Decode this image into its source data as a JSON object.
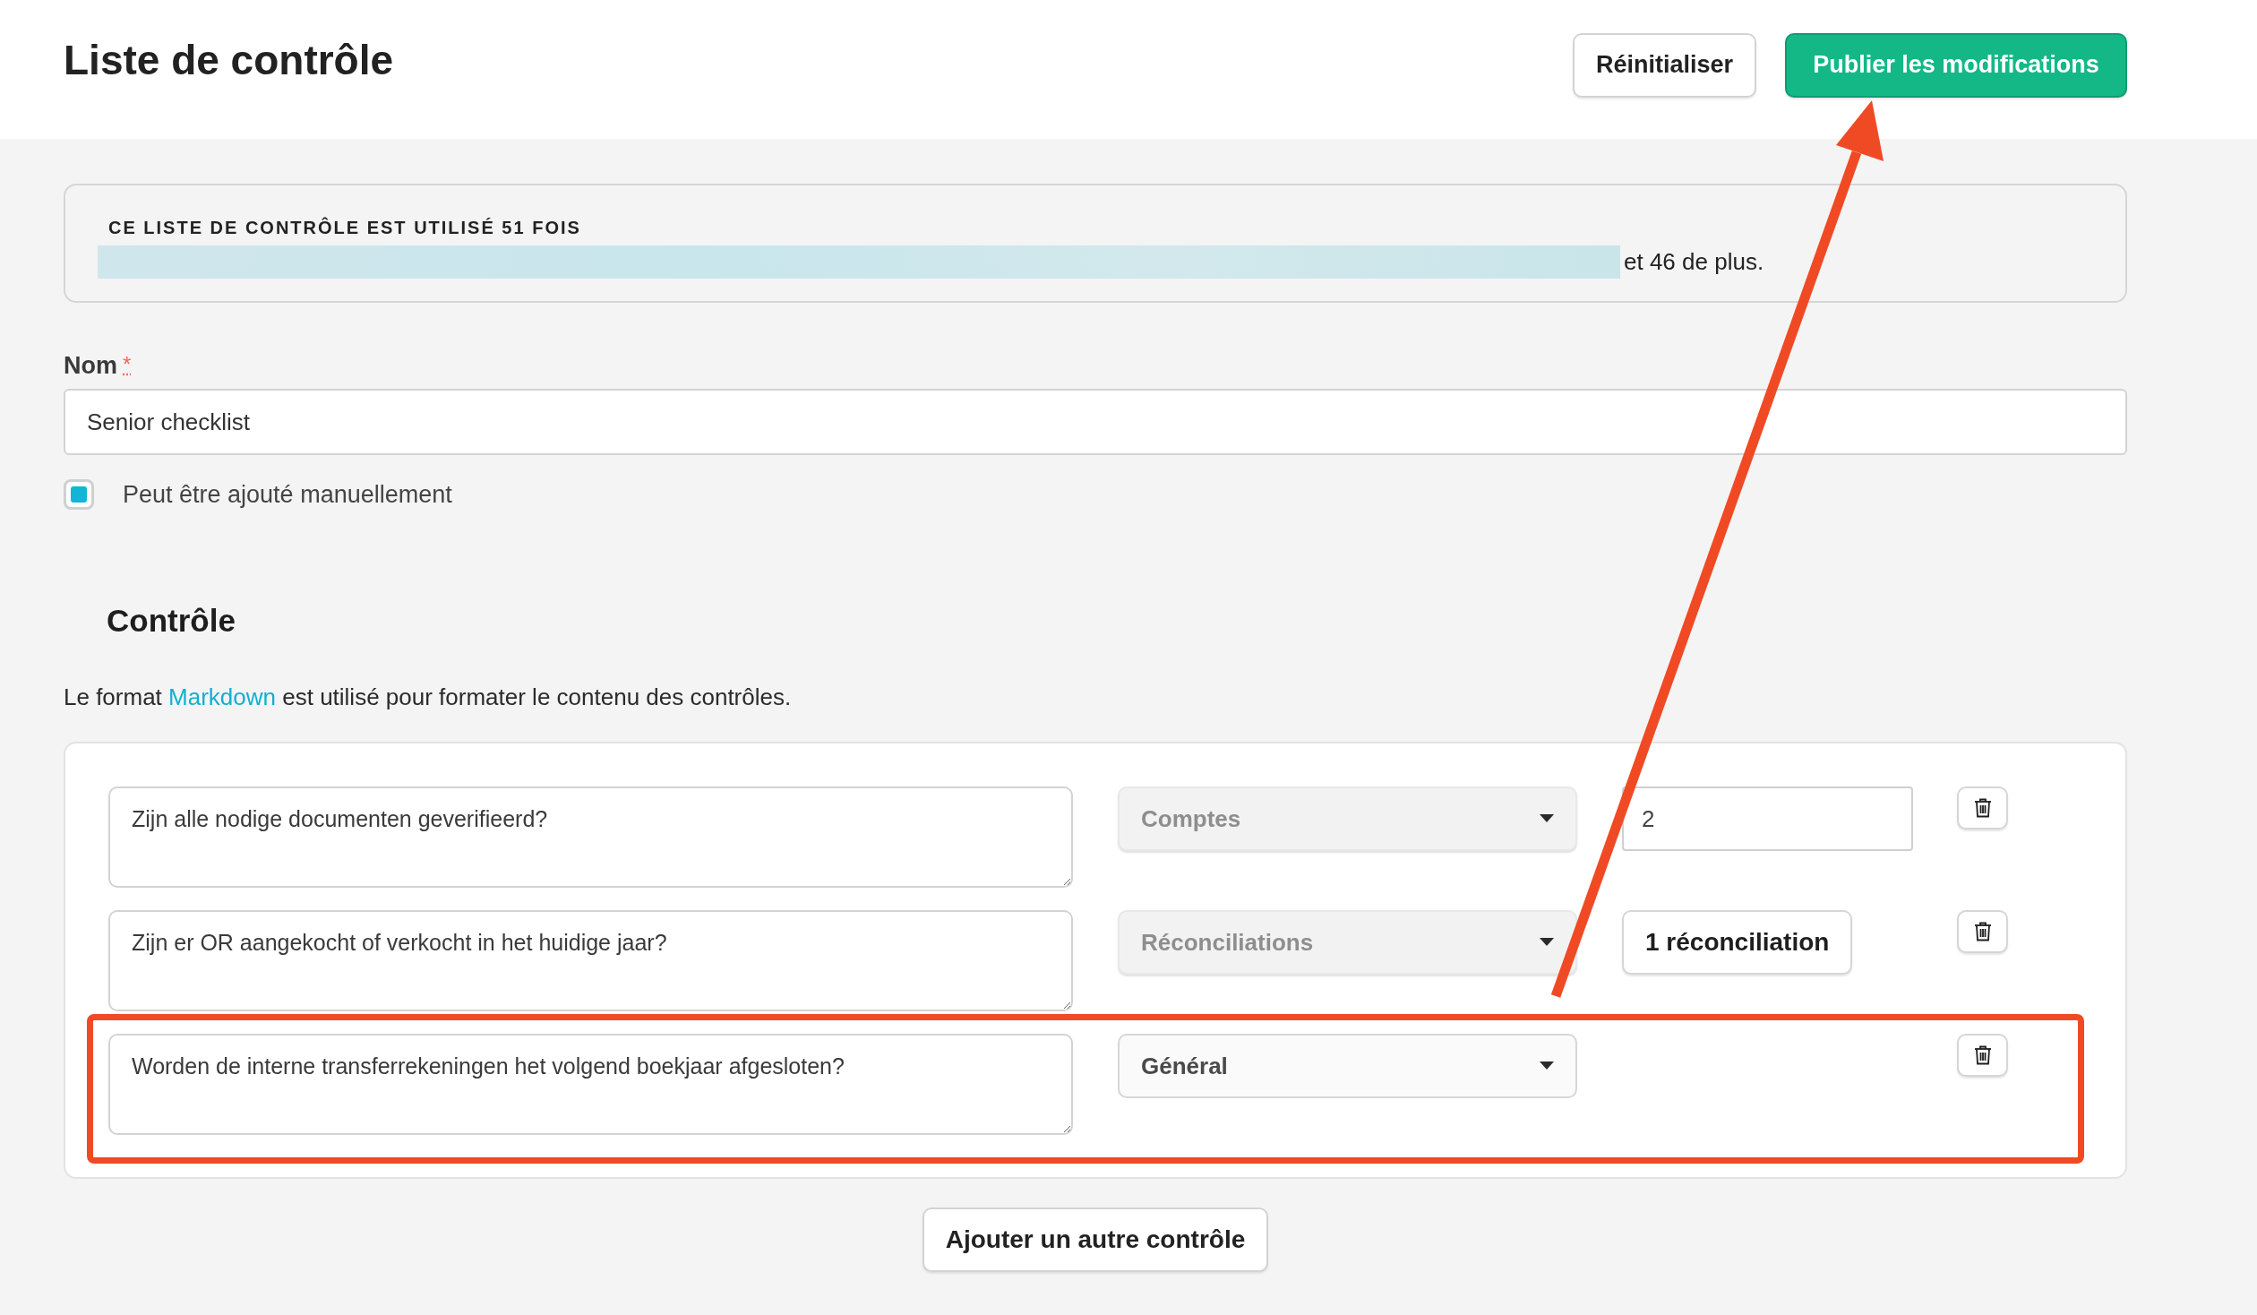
{
  "header": {
    "title": "Liste de contrôle",
    "buttons": [
      {
        "label": "Réinitialiser",
        "kind": "secondary"
      },
      {
        "label": "Publier les modifications",
        "kind": "primary"
      }
    ]
  },
  "usage": {
    "heading": "CE LISTE DE CONTRÔLE EST UTILISÉ 51 FOIS",
    "more": "et 46 de plus."
  },
  "name_field": {
    "label": "Nom",
    "required_mark": "*",
    "value": "Senior checklist"
  },
  "manual_option": {
    "label": "Peut être ajouté manuellement",
    "checked": true
  },
  "section": {
    "title": "Contrôle",
    "note_before": "Le format",
    "link": "Markdown",
    "note_after": "est utilisé pour formater le contenu des contrôles."
  },
  "controls": [
    {
      "question": "Zijn alle nodige documenten geverifieerd?",
      "category": "Comptes",
      "disabled": true,
      "kind": "number",
      "extra": "2",
      "highlighted": false
    },
    {
      "question": "Zijn er OR aangekocht of verkocht in het huidige jaar?",
      "category": "Réconciliations",
      "disabled": true,
      "kind": "button",
      "extra": "1 réconciliation",
      "highlighted": false
    },
    {
      "question": "Worden de interne transferrekeningen het volgend boekjaar afgesloten?",
      "category": "Général",
      "disabled": false,
      "kind": "none",
      "highlighted": true
    }
  ],
  "add_button": "Ajouter un autre contrôle"
}
